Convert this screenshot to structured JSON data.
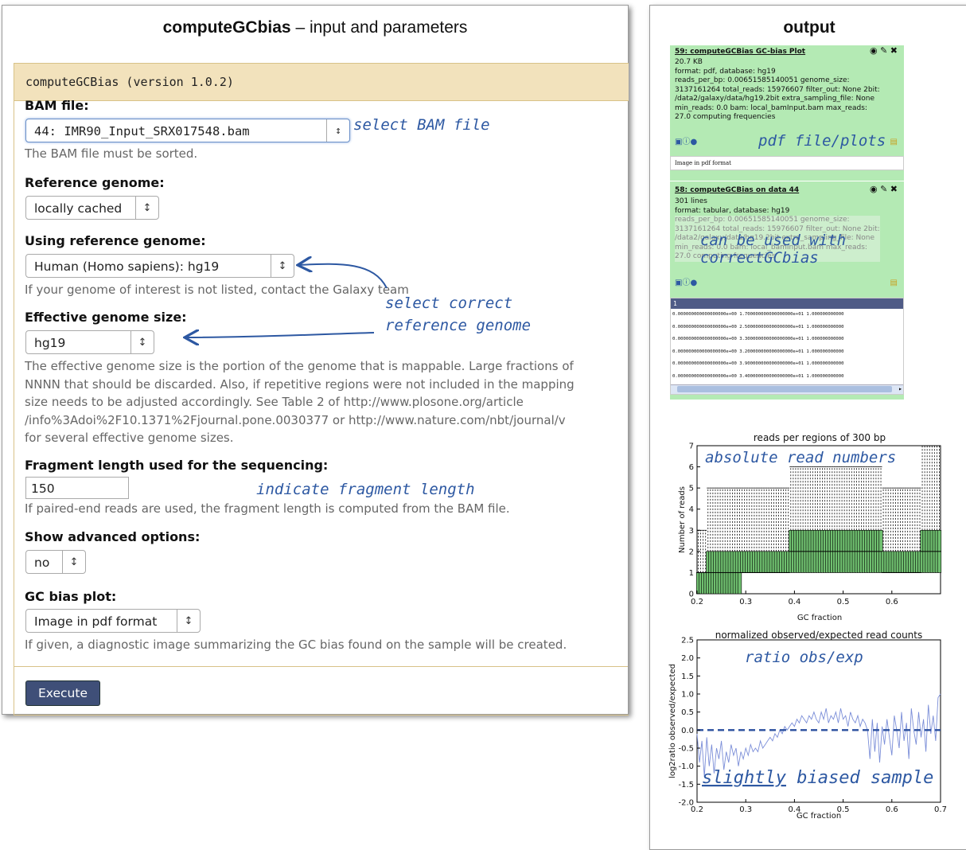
{
  "left": {
    "title_bold": "computeGCbias",
    "title_rest": " – input and parameters",
    "tool_header": "computeGCBias (version 1.0.2)",
    "bam_label": "BAM file:",
    "bam_value": "44: IMR90_Input_SRX017548.bam",
    "bam_help": "The BAM file must be sorted.",
    "ref_label": "Reference genome:",
    "ref_value": "locally cached",
    "using_label": "Using reference genome:",
    "using_value": "Human (Homo sapiens): hg19",
    "using_help": "If your genome of interest is not listed, contact the Galaxy team",
    "eff_label": "Effective genome size:",
    "eff_value": "hg19",
    "eff_help": [
      "The effective genome size is the portion of the genome that is mappable. Large fractions of",
      "NNNN that should be discarded. Also, if repetitive regions were not included in the mapping",
      "size needs to be adjusted accordingly. See Table 2 of http://www.plosone.org/article",
      "/info%3Adoi%2F10.1371%2Fjournal.pone.0030377 or http://www.nature.com/nbt/journal/v",
      "for several effective genome sizes."
    ],
    "frag_label": "Fragment length used for the sequencing:",
    "frag_value": "150",
    "frag_help": "If paired-end reads are used, the fragment length is computed from the BAM file.",
    "adv_label": "Show advanced options:",
    "adv_value": "no",
    "gc_label": "GC bias plot:",
    "gc_value": "Image in pdf format",
    "gc_help": "If given, a diagnostic image summarizing the GC bias found on the sample will be created.",
    "execute": "Execute"
  },
  "annotations": {
    "select_bam": "select BAM file",
    "select_ref_1": "select correct",
    "select_ref_2": "reference genome",
    "frag": "indicate fragment length",
    "pdf": "pdf file/plots",
    "used_1": "can be used with",
    "used_2": "correctGCbias",
    "abs": "absolute read numbers",
    "ratio": "ratio obs/exp",
    "slightly": "slightly",
    "biased": " biased sample"
  },
  "right": {
    "title": "output",
    "hist1": {
      "title": "59: computeGCBias GC-bias Plot",
      "lines": [
        "20.7 KB",
        "format: pdf, database: hg19",
        "reads_per_bp: 0.00651585140051 genome_size:",
        "3137161264 total_reads: 15976607 filter_out: None 2bit:",
        "/data2/galaxy/data/hg19.2bit extra_sampling_file: None",
        "min_reads: 0.0 bam: local_bamInput.bam max_reads:",
        "27.0 computing frequencies"
      ],
      "preview": "Image in pdf format"
    },
    "hist2": {
      "title": "58: computeGCBias on data 44",
      "lines": [
        "301 lines",
        "format: tabular, database: hg19",
        "reads_per_bp: 0.00651585140051 genome_size:",
        "3137161264 total_reads: 15976607 filter_out: None 2bit:",
        "/data2/galaxy/data/hg19.2bit extra_sampling_file: None",
        "min_reads: 0.0 bam: local_bamInput.bam max_reads:",
        "27.0 computing frequencies"
      ],
      "table_header": "1",
      "rows": [
        "0.000000000000000000e+00 1.700000000000000000e+01 1.000000000000",
        "0.000000000000000000e+00 2.500000000000000000e+01 1.000000000000",
        "0.000000000000000000e+00 3.300000000000000000e+01 1.000000000000",
        "0.000000000000000000e+00 3.200000000000000000e+01 1.000000000000",
        "0.000000000000000000e+00 3.900000000000000000e+01 1.000000000000",
        "0.000000000000000000e+00 3.400000000000000000e+01 1.000000000000"
      ]
    }
  },
  "chart_data": [
    {
      "type": "box",
      "title": "reads per regions of 300 bp",
      "xlabel": "GC fraction",
      "ylabel": "Number of reads",
      "xlim": [
        0.2,
        0.7
      ],
      "ylim": [
        0,
        7
      ],
      "xticks": [
        "0.2",
        "0.3",
        "0.4",
        "0.5",
        "0.6"
      ],
      "yticks": [
        "0",
        "1",
        "2",
        "3",
        "4",
        "5",
        "6",
        "7"
      ],
      "segments": [
        {
          "x_from": 0.2,
          "x_to": 0.22,
          "q1": 0,
          "median": 1,
          "q3": 1,
          "whisker_high": 3
        },
        {
          "x_from": 0.22,
          "x_to": 0.29,
          "q1": 0,
          "median": 1,
          "q3": 2,
          "whisker_high": 5
        },
        {
          "x_from": 0.29,
          "x_to": 0.39,
          "q1": 1,
          "median": 1,
          "q3": 2,
          "whisker_high": 5
        },
        {
          "x_from": 0.39,
          "x_to": 0.58,
          "q1": 1,
          "median": 2,
          "q3": 3,
          "whisker_high": 6
        },
        {
          "x_from": 0.58,
          "x_to": 0.66,
          "q1": 1,
          "median": 1,
          "q3": 2,
          "whisker_high": 5
        },
        {
          "x_from": 0.66,
          "x_to": 0.7,
          "q1": 1,
          "median": 2,
          "q3": 3,
          "whisker_high": 7
        }
      ]
    },
    {
      "type": "line",
      "title": "normalized observed/expected read counts",
      "xlabel": "GC fraction",
      "ylabel": "log2ratio observed/expected",
      "xlim": [
        0.2,
        0.7
      ],
      "ylim": [
        -2.0,
        2.5
      ],
      "xticks": [
        "0.2",
        "0.3",
        "0.4",
        "0.5",
        "0.6",
        "0.7"
      ],
      "yticks": [
        "-2.0",
        "-1.5",
        "-1.0",
        "-0.5",
        "0.0",
        "0.5",
        "1.0",
        "1.5",
        "2.0",
        "2.5"
      ],
      "reference_line": {
        "y": 0.0,
        "style": "dashed",
        "x_from": 0.2,
        "x_to": 0.7
      },
      "series": [
        {
          "color": "#7b8ed8",
          "x": [
            0.2,
            0.205,
            0.21,
            0.215,
            0.22,
            0.225,
            0.23,
            0.235,
            0.24,
            0.245,
            0.25,
            0.255,
            0.26,
            0.265,
            0.27,
            0.275,
            0.28,
            0.285,
            0.29,
            0.295,
            0.3,
            0.305,
            0.31,
            0.315,
            0.32,
            0.325,
            0.33,
            0.335,
            0.34,
            0.345,
            0.35,
            0.355,
            0.36,
            0.365,
            0.37,
            0.375,
            0.38,
            0.385,
            0.39,
            0.395,
            0.4,
            0.405,
            0.41,
            0.415,
            0.42,
            0.425,
            0.43,
            0.435,
            0.44,
            0.445,
            0.45,
            0.455,
            0.46,
            0.465,
            0.47,
            0.475,
            0.48,
            0.485,
            0.49,
            0.495,
            0.5,
            0.505,
            0.51,
            0.515,
            0.52,
            0.525,
            0.53,
            0.535,
            0.54,
            0.545,
            0.55,
            0.555,
            0.56,
            0.565,
            0.57,
            0.575,
            0.58,
            0.585,
            0.59,
            0.595,
            0.6,
            0.605,
            0.61,
            0.615,
            0.62,
            0.625,
            0.63,
            0.635,
            0.64,
            0.645,
            0.65,
            0.655,
            0.66,
            0.665,
            0.67,
            0.675,
            0.68,
            0.685,
            0.69,
            0.695,
            0.7
          ],
          "values": [
            -0.1,
            -0.9,
            -0.3,
            -1.3,
            -0.2,
            -1.0,
            -0.4,
            -1.2,
            -0.5,
            -0.8,
            -0.3,
            -1.1,
            -0.6,
            -0.9,
            -0.4,
            -0.7,
            -0.5,
            -1.0,
            -0.6,
            -0.8,
            -0.5,
            -0.7,
            -0.4,
            -0.6,
            -0.5,
            -0.6,
            -0.3,
            -0.5,
            -0.4,
            -0.3,
            -0.2,
            -0.3,
            -0.1,
            -0.2,
            0.0,
            -0.1,
            0.1,
            0.0,
            0.1,
            0.2,
            0.1,
            0.3,
            0.2,
            0.4,
            0.3,
            0.2,
            0.4,
            0.3,
            0.5,
            0.3,
            0.2,
            0.5,
            0.3,
            0.6,
            0.2,
            0.4,
            0.3,
            0.5,
            0.2,
            0.6,
            0.3,
            0.4,
            0.1,
            0.5,
            0.3,
            0.2,
            0.4,
            0.1,
            0.3,
            0.2,
            0.0,
            -0.8,
            0.3,
            -0.6,
            0.2,
            -0.9,
            0.1,
            -0.4,
            0.3,
            -0.2,
            -0.7,
            0.4,
            0.0,
            -0.5,
            0.5,
            -0.3,
            0.2,
            -0.8,
            0.6,
            0.0,
            -0.4,
            0.5,
            -0.2,
            0.3,
            -0.6,
            0.7,
            -0.1,
            0.4,
            -0.3,
            0.9,
            1.0
          ]
        }
      ]
    }
  ]
}
